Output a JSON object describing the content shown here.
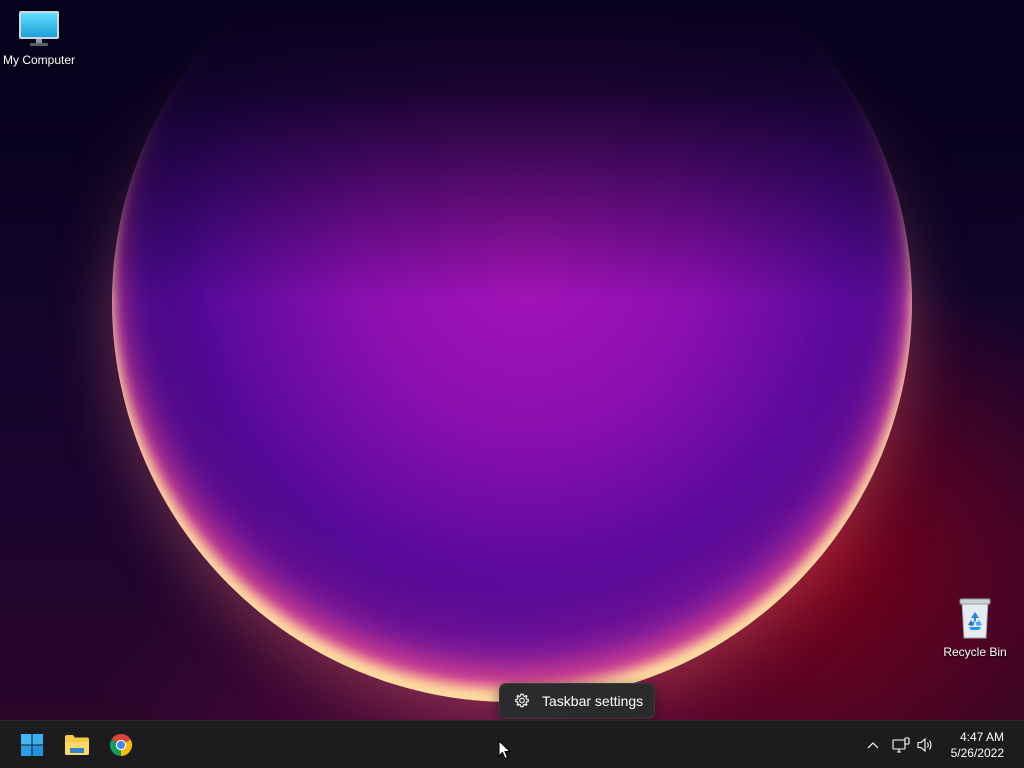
{
  "desktop": {
    "icons": [
      {
        "label": "My Computer",
        "icon": "computer-monitor-icon"
      },
      {
        "label": "Recycle Bin",
        "icon": "recycle-bin-icon"
      }
    ],
    "wallpaper": {
      "accent": "#a614b8",
      "glow": "#ffe6a0",
      "rim": "#ff5a8c"
    }
  },
  "context_menu": {
    "items": [
      {
        "label": "Taskbar settings",
        "icon": "gear-icon"
      }
    ]
  },
  "taskbar": {
    "pinned": [
      {
        "name": "Start",
        "icon": "windows-logo-icon"
      },
      {
        "name": "File Explorer",
        "icon": "folder-icon"
      },
      {
        "name": "Google Chrome",
        "icon": "chrome-icon"
      }
    ],
    "tray": {
      "icons": [
        "chevron-up-icon",
        "network-icon",
        "volume-icon"
      ]
    },
    "clock": {
      "time": "4:47 AM",
      "date": "5/26/2022"
    },
    "background": "#1c1c1f"
  }
}
